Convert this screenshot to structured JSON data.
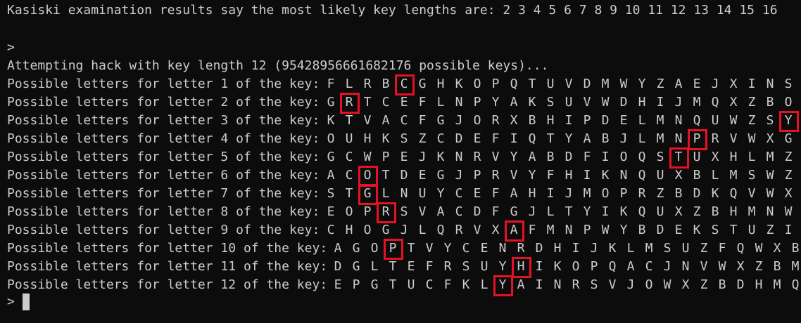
{
  "terminal": {
    "kasiski_line": "Kasiski examination results say the most likely key lengths are: 2 3 4 5 6 7 8 9 10 11 12 13 14 15 16",
    "prompt_1": ">",
    "attempt_line": "Attempting hack with key length 12 (95428956661682176 possible keys)...",
    "rows": [
      {
        "prefix": "Possible letters for letter 1 of the key:",
        "letters": [
          "F",
          "L",
          "R",
          "B",
          "C",
          "G",
          "H",
          "K",
          "O",
          "P",
          "Q",
          "T",
          "U",
          "V",
          "D",
          "M",
          "W",
          "Y",
          "Z",
          "A",
          "E",
          "J",
          "X",
          "I",
          "N",
          "S"
        ],
        "highlight": 4
      },
      {
        "prefix": "Possible letters for letter 2 of the key:",
        "letters": [
          "G",
          "R",
          "T",
          "C",
          "E",
          "F",
          "L",
          "N",
          "P",
          "Y",
          "A",
          "K",
          "S",
          "U",
          "V",
          "W",
          "D",
          "H",
          "I",
          "J",
          "M",
          "Q",
          "X",
          "Z",
          "B",
          "O"
        ],
        "highlight": 1
      },
      {
        "prefix": "Possible letters for letter 3 of the key:",
        "letters": [
          "K",
          "T",
          "V",
          "A",
          "C",
          "F",
          "G",
          "J",
          "O",
          "R",
          "X",
          "B",
          "H",
          "I",
          "P",
          "D",
          "E",
          "L",
          "M",
          "N",
          "Q",
          "U",
          "W",
          "Z",
          "S",
          "Y"
        ],
        "highlight": 25
      },
      {
        "prefix": "Possible letters for letter 4 of the key:",
        "letters": [
          "O",
          "U",
          "H",
          "K",
          "S",
          "Z",
          "C",
          "D",
          "E",
          "F",
          "I",
          "Q",
          "T",
          "Y",
          "A",
          "B",
          "J",
          "L",
          "M",
          "N",
          "P",
          "R",
          "V",
          "W",
          "X",
          "G"
        ],
        "highlight": 20
      },
      {
        "prefix": "Possible letters for letter 5 of the key:",
        "letters": [
          "G",
          "C",
          "W",
          "P",
          "E",
          "J",
          "K",
          "N",
          "R",
          "V",
          "Y",
          "A",
          "B",
          "D",
          "F",
          "I",
          "O",
          "Q",
          "S",
          "T",
          "U",
          "X",
          "H",
          "L",
          "M",
          "Z"
        ],
        "highlight": 19
      },
      {
        "prefix": "Possible letters for letter 6 of the key:",
        "letters": [
          "A",
          "C",
          "O",
          "T",
          "D",
          "E",
          "G",
          "J",
          "P",
          "R",
          "V",
          "Y",
          "F",
          "H",
          "I",
          "K",
          "N",
          "Q",
          "U",
          "X",
          "B",
          "L",
          "M",
          "S",
          "W",
          "Z"
        ],
        "highlight": 2
      },
      {
        "prefix": "Possible letters for letter 7 of the key:",
        "letters": [
          "S",
          "T",
          "G",
          "L",
          "N",
          "U",
          "Y",
          "C",
          "E",
          "F",
          "A",
          "H",
          "I",
          "J",
          "M",
          "O",
          "P",
          "R",
          "Z",
          "B",
          "D",
          "K",
          "Q",
          "V",
          "W",
          "X"
        ],
        "highlight": 2
      },
      {
        "prefix": "Possible letters for letter 8 of the key:",
        "letters": [
          "E",
          "O",
          "P",
          "R",
          "S",
          "V",
          "A",
          "C",
          "D",
          "F",
          "G",
          "J",
          "L",
          "T",
          "Y",
          "I",
          "K",
          "Q",
          "U",
          "X",
          "Z",
          "B",
          "H",
          "M",
          "N",
          "W"
        ],
        "highlight": 3
      },
      {
        "prefix": "Possible letters for letter 9 of the key:",
        "letters": [
          "C",
          "H",
          "O",
          "G",
          "J",
          "L",
          "Q",
          "R",
          "V",
          "X",
          "A",
          "F",
          "M",
          "N",
          "P",
          "W",
          "Y",
          "B",
          "D",
          "E",
          "K",
          "S",
          "T",
          "U",
          "Z",
          "I"
        ],
        "highlight": 10
      },
      {
        "prefix": "Possible letters for letter 10 of the key:",
        "letters": [
          "A",
          "G",
          "O",
          "P",
          "T",
          "V",
          "Y",
          "C",
          "E",
          "N",
          "R",
          "D",
          "H",
          "I",
          "J",
          "K",
          "L",
          "M",
          "S",
          "U",
          "Z",
          "F",
          "Q",
          "W",
          "X",
          "B"
        ],
        "highlight": 3
      },
      {
        "prefix": "Possible letters for letter 11 of the key:",
        "letters": [
          "D",
          "G",
          "L",
          "T",
          "E",
          "F",
          "R",
          "S",
          "U",
          "Y",
          "H",
          "I",
          "K",
          "O",
          "P",
          "Q",
          "A",
          "C",
          "J",
          "N",
          "V",
          "W",
          "X",
          "Z",
          "B",
          "M"
        ],
        "highlight": 10
      },
      {
        "prefix": "Possible letters for letter 12 of the key:",
        "letters": [
          "E",
          "P",
          "G",
          "T",
          "U",
          "C",
          "F",
          "K",
          "L",
          "Y",
          "A",
          "I",
          "N",
          "R",
          "S",
          "V",
          "J",
          "O",
          "W",
          "X",
          "Z",
          "B",
          "D",
          "H",
          "M",
          "Q"
        ],
        "highlight": 9
      }
    ],
    "prompt_2": ">",
    "colors": {
      "background": "#0c0c0c",
      "text": "#cccccc",
      "highlight_box": "#e81123"
    }
  }
}
